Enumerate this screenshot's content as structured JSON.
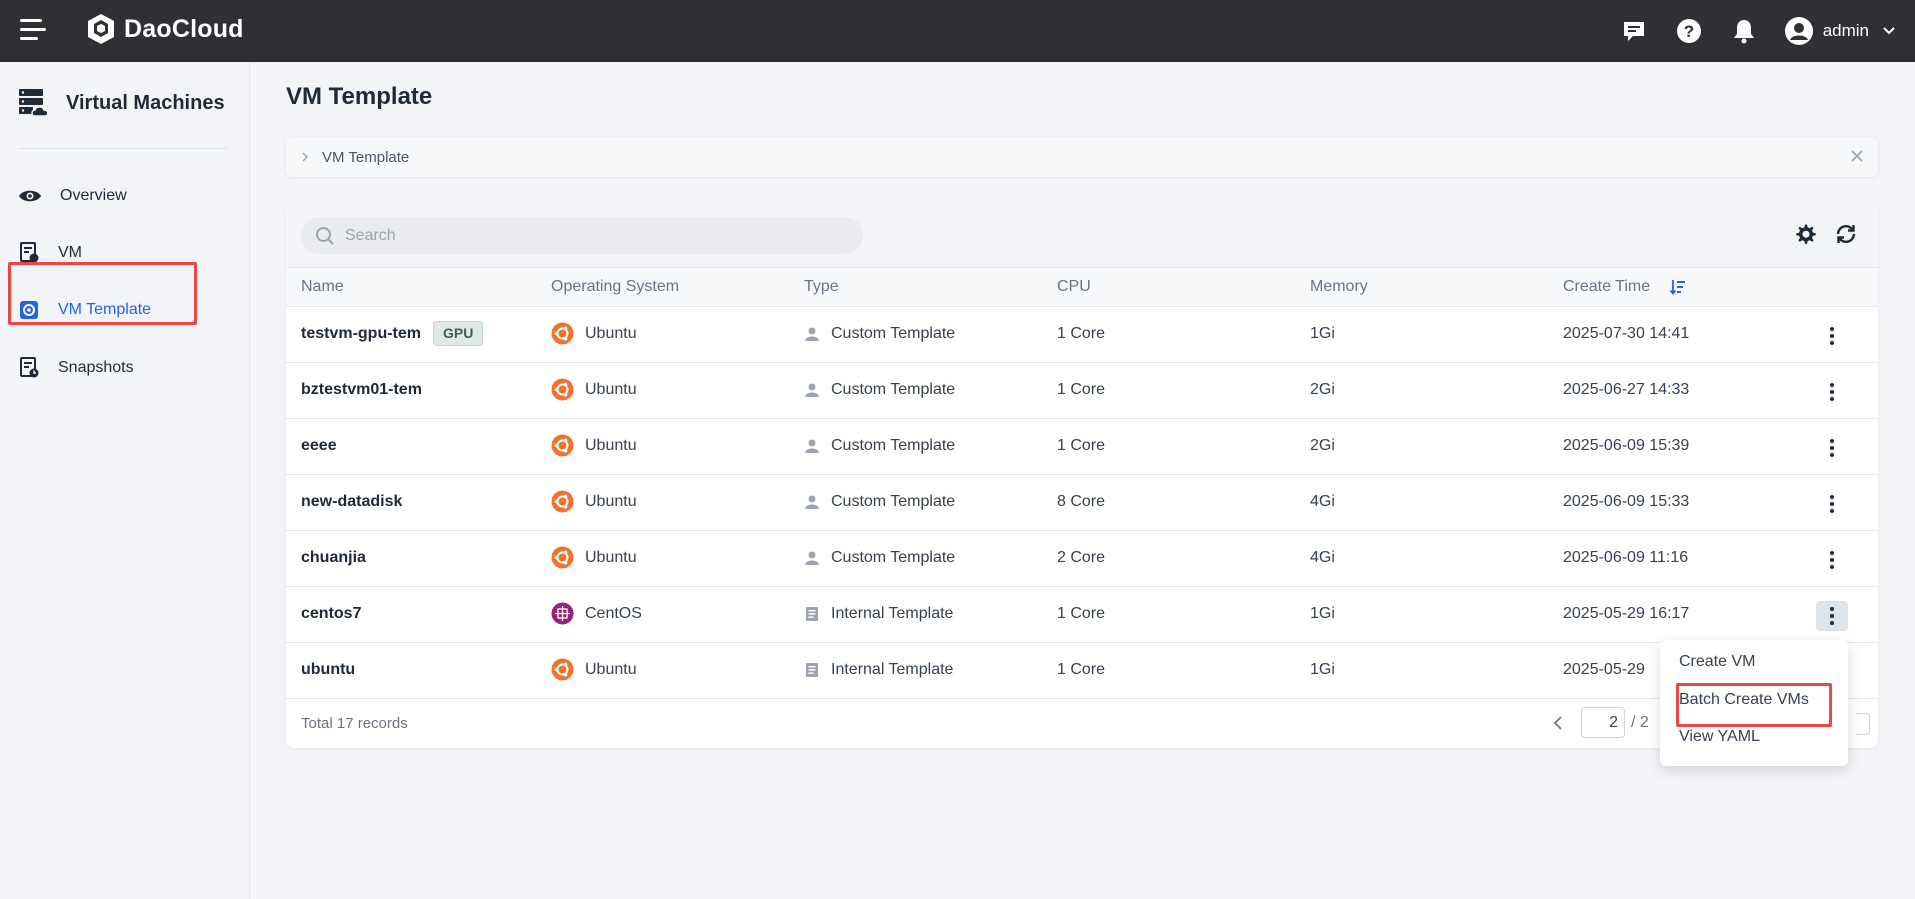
{
  "app": {
    "brand": "DaoCloud",
    "user": "admin"
  },
  "sidebar": {
    "title": "Virtual Machines",
    "items": [
      {
        "label": "Overview",
        "icon": "eye-icon"
      },
      {
        "label": "VM",
        "icon": "vm-icon"
      },
      {
        "label": "VM Template",
        "icon": "template-icon",
        "active": true
      },
      {
        "label": "Snapshots",
        "icon": "snapshot-icon"
      }
    ]
  },
  "page": {
    "title": "VM Template",
    "breadcrumb": "VM Template"
  },
  "search": {
    "placeholder": "Search"
  },
  "table": {
    "headers": [
      "Name",
      "Operating System",
      "Type",
      "CPU",
      "Memory",
      "Create Time"
    ],
    "rows": [
      {
        "name": "testvm-gpu-tem",
        "tag": "GPU",
        "os": "Ubuntu",
        "type": "Custom Template",
        "cpu": "1 Core",
        "memory": "1Gi",
        "created": "2025-07-30 14:41"
      },
      {
        "name": "bztestvm01-tem",
        "os": "Ubuntu",
        "type": "Custom Template",
        "cpu": "1 Core",
        "memory": "2Gi",
        "created": "2025-06-27 14:33"
      },
      {
        "name": "eeee",
        "os": "Ubuntu",
        "type": "Custom Template",
        "cpu": "1 Core",
        "memory": "2Gi",
        "created": "2025-06-09 15:39"
      },
      {
        "name": "new-datadisk",
        "os": "Ubuntu",
        "type": "Custom Template",
        "cpu": "8 Core",
        "memory": "4Gi",
        "created": "2025-06-09 15:33"
      },
      {
        "name": "chuanjia",
        "os": "Ubuntu",
        "type": "Custom Template",
        "cpu": "2 Core",
        "memory": "4Gi",
        "created": "2025-06-09 11:16"
      },
      {
        "name": "centos7",
        "os": "CentOS",
        "type": "Internal Template",
        "cpu": "1 Core",
        "memory": "1Gi",
        "created": "2025-05-29 16:17"
      },
      {
        "name": "ubuntu",
        "os": "Ubuntu",
        "type": "Internal Template",
        "cpu": "1 Core",
        "memory": "1Gi",
        "created": "2025-05-29"
      }
    ]
  },
  "footer": {
    "total": "Total 17 records",
    "current_page": "2",
    "page_total": "/ 2"
  },
  "dropdown": {
    "items": [
      "Create VM",
      "Batch Create VMs",
      "View YAML"
    ]
  },
  "colors": {
    "accent": "#2563eb",
    "highlight": "#ef4444",
    "ubuntu": "#f0742f",
    "centos": "#932279"
  }
}
